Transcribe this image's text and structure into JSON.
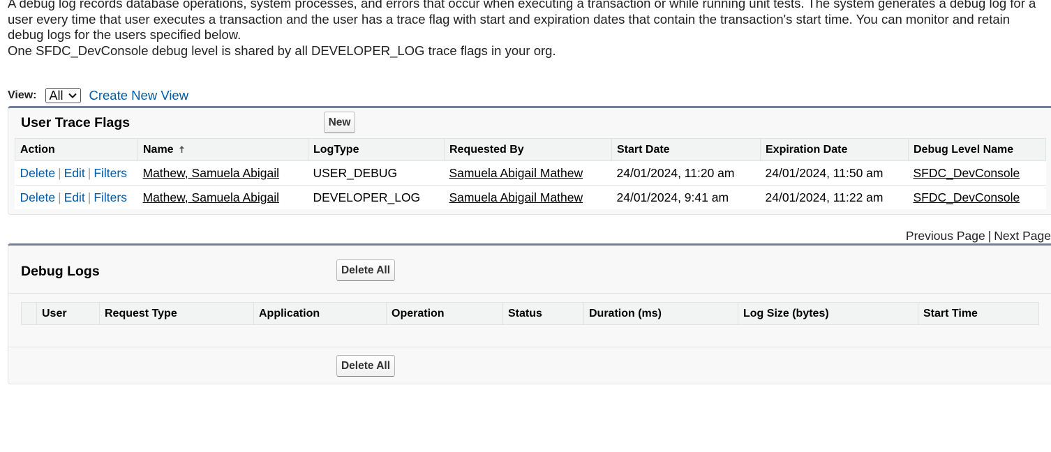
{
  "intro": {
    "line1": "A debug log records database operations, system processes, and errors that occur when executing a transaction or while running unit tests. The system generates a debug log for a user every time that user executes a transaction and the user has a trace flag with start and expiration dates that contain the transaction's start time. You can monitor and retain debug logs for the users specified below.",
    "line2": "One SFDC_DevConsole debug level is shared by all DEVELOPER_LOG trace flags in your org."
  },
  "view": {
    "label": "View:",
    "selected": "All",
    "create_link": "Create New View"
  },
  "trace_flags": {
    "title": "User Trace Flags",
    "new_button": "New",
    "columns": [
      "Action",
      "Name",
      "LogType",
      "Requested By",
      "Start Date",
      "Expiration Date",
      "Debug Level Name"
    ],
    "sorted_column": "Name",
    "rows": [
      {
        "actions": [
          "Delete",
          "Edit",
          "Filters"
        ],
        "name": "Mathew, Samuela Abigail",
        "log_type": "USER_DEBUG",
        "requested_by": "Samuela Abigail Mathew",
        "start_date": "24/01/2024, 11:20 am",
        "expiration_date": "24/01/2024, 11:50 am",
        "debug_level": "SFDC_DevConsole"
      },
      {
        "actions": [
          "Delete",
          "Edit",
          "Filters"
        ],
        "name": "Mathew, Samuela Abigail",
        "log_type": "DEVELOPER_LOG",
        "requested_by": "Samuela Abigail Mathew",
        "start_date": "24/01/2024, 9:41 am",
        "expiration_date": "24/01/2024, 11:22 am",
        "debug_level": "SFDC_DevConsole"
      }
    ]
  },
  "pager": {
    "previous": "Previous Page",
    "separator": "|",
    "next": "Next Page"
  },
  "debug_logs": {
    "title": "Debug Logs",
    "delete_all_top": "Delete All",
    "delete_all_bottom": "Delete All",
    "columns": [
      "",
      "User",
      "Request Type",
      "Application",
      "Operation",
      "Status",
      "Duration (ms)",
      "Log Size (bytes)",
      "Start Time"
    ]
  },
  "colors": {
    "link": "#015ba7",
    "panel_top_border": "#747e96",
    "header_bg": "#f2f3f3",
    "panel_bg": "#f8f8f8"
  }
}
